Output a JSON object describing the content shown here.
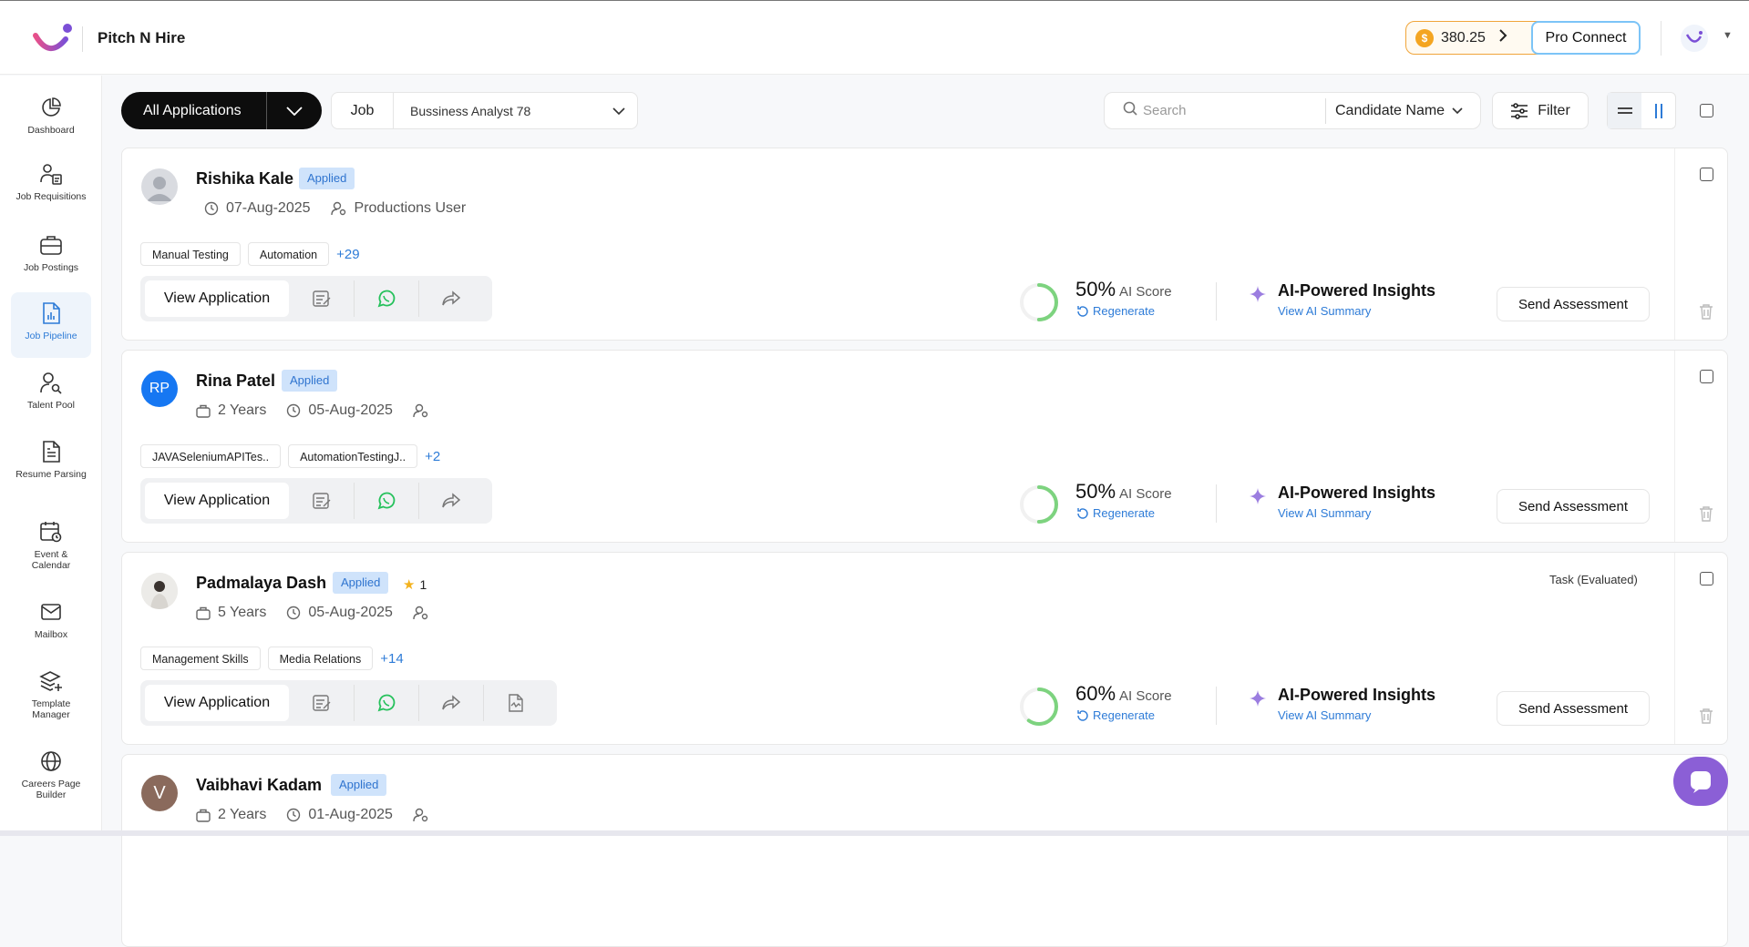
{
  "app": {
    "brand": "Pitch N Hire",
    "coins": "380.25",
    "pro_connect": "Pro Connect"
  },
  "sidebar": {
    "items": [
      {
        "label": "Dashboard",
        "icon": "pie-chart-icon",
        "active": false
      },
      {
        "label": "Job Requisitions",
        "icon": "user-document-icon",
        "active": false
      },
      {
        "label": "Job Postings",
        "icon": "briefcase-icon",
        "active": false
      },
      {
        "label": "Job Pipeline",
        "icon": "bar-chart-document-icon",
        "active": true
      },
      {
        "label": "Talent Pool",
        "icon": "user-search-icon",
        "active": false
      },
      {
        "label": "Resume Parsing",
        "icon": "document-lines-icon",
        "active": false
      },
      {
        "label": "Event & Calendar",
        "icon": "calendar-icon",
        "active": false
      },
      {
        "label": "Mailbox",
        "icon": "mail-icon",
        "active": false
      },
      {
        "label": "Template Manager",
        "icon": "layers-icon",
        "active": false
      },
      {
        "label": "Careers Page Builder",
        "icon": "globe-icon",
        "active": false
      }
    ]
  },
  "toolbar": {
    "all_applications": "All Applications",
    "job_label": "Job",
    "job_value": "Bussiness Analyst 78",
    "search_placeholder": "Search",
    "search_category": "Candidate Name",
    "filter_label": "Filter"
  },
  "candidates": [
    {
      "name": "Rishika Kale",
      "status": "Applied",
      "initials": "",
      "avatar_type": "placeholder",
      "meta": [
        {
          "icon": "clock-icon",
          "text": "07-Aug-2025"
        },
        {
          "icon": "user-gear-icon",
          "text": "Productions User"
        }
      ],
      "tags": [
        "Manual Testing",
        "Automation"
      ],
      "more_tags": "+29",
      "view_label": "View Application",
      "score": "50%",
      "score_label": "AI Score",
      "score_value": 50,
      "regenerate": "Regenerate",
      "ai_title": "AI-Powered Insights",
      "ai_link": "View AI Summary",
      "send_label": "Send Assessment",
      "task": "",
      "rating": ""
    },
    {
      "name": "Rina Patel",
      "status": "Applied",
      "initials": "RP",
      "avatar_type": "initials",
      "meta": [
        {
          "icon": "briefcase-icon",
          "text": "2 Years"
        },
        {
          "icon": "clock-icon",
          "text": "05-Aug-2025"
        },
        {
          "icon": "user-gear-icon",
          "text": ""
        }
      ],
      "tags": [
        "JAVASeleniumAPITes..",
        "AutomationTestingJ.."
      ],
      "more_tags": "+2",
      "view_label": "View Application",
      "score": "50%",
      "score_label": "AI Score",
      "score_value": 50,
      "regenerate": "Regenerate",
      "ai_title": "AI-Powered Insights",
      "ai_link": "View AI Summary",
      "send_label": "Send Assessment",
      "task": "",
      "rating": ""
    },
    {
      "name": "Padmalaya Dash",
      "status": "Applied",
      "initials": "",
      "avatar_type": "photo",
      "meta": [
        {
          "icon": "briefcase-icon",
          "text": "5 Years"
        },
        {
          "icon": "clock-icon",
          "text": "05-Aug-2025"
        },
        {
          "icon": "user-gear-icon",
          "text": ""
        }
      ],
      "tags": [
        "Management Skills",
        "Media Relations"
      ],
      "more_tags": "+14",
      "view_label": "View Application",
      "score": "60%",
      "score_label": "AI Score",
      "score_value": 60,
      "regenerate": "Regenerate",
      "ai_title": "AI-Powered Insights",
      "ai_link": "View AI Summary",
      "send_label": "Send Assessment",
      "task": "Task (Evaluated)",
      "rating": "1"
    },
    {
      "name": "Vaibhavi Kadam",
      "status": "Applied",
      "initials": "V",
      "avatar_type": "initials",
      "meta": [
        {
          "icon": "briefcase-icon",
          "text": "2 Years"
        },
        {
          "icon": "clock-icon",
          "text": "01-Aug-2025"
        },
        {
          "icon": "user-gear-icon",
          "text": ""
        }
      ],
      "tags": [],
      "more_tags": "",
      "view_label": "",
      "score": "",
      "score_label": "",
      "regenerate": "",
      "ai_title": "",
      "ai_link": "",
      "send_label": "",
      "task": "",
      "rating": ""
    }
  ],
  "colors": {
    "accent": "#2d7bd7",
    "status_bg": "#cfe3fb",
    "score_ring": "#7dd37f",
    "chat_fab": "#8b5fd6"
  }
}
